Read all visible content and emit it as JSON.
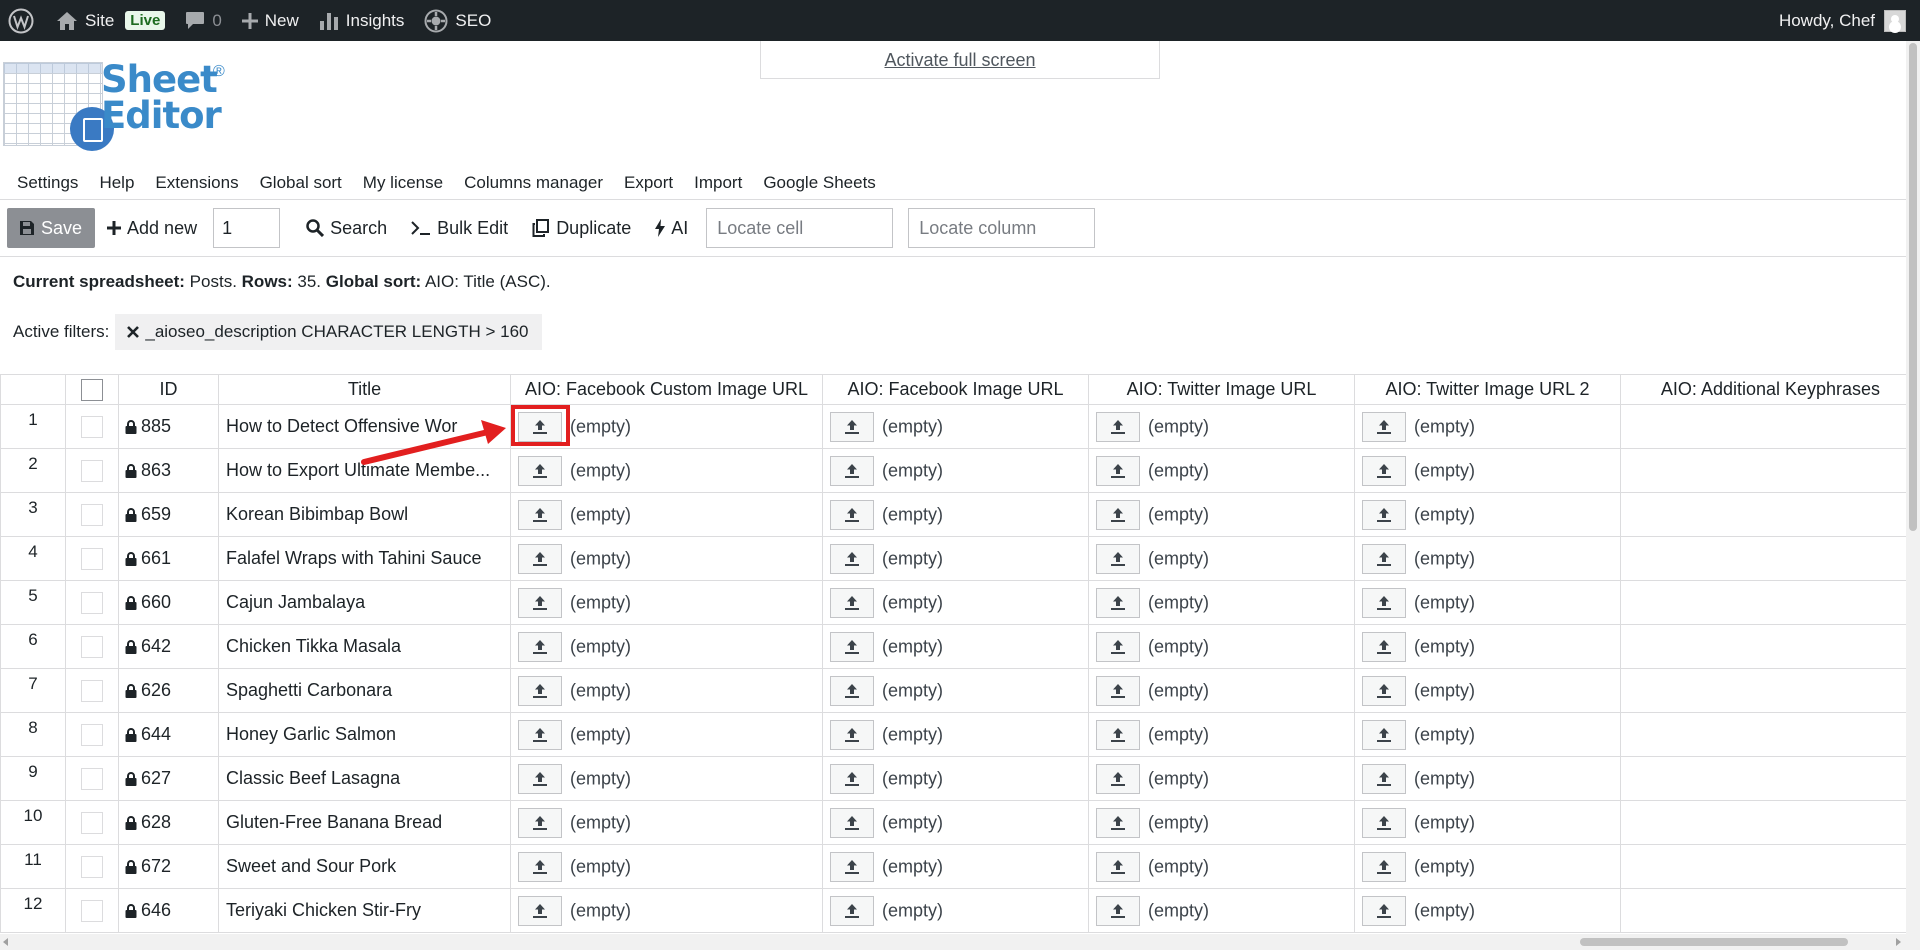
{
  "admin_bar": {
    "site": "Site",
    "live": "Live",
    "comments_count": "0",
    "new": "New",
    "insights": "Insights",
    "seo": "SEO",
    "greeting": "Howdy, Chef"
  },
  "fullscreen_link": "Activate full screen",
  "logo": {
    "line1": "Sheet",
    "line2": "Editor",
    "reg": "®"
  },
  "menu": [
    "Settings",
    "Help",
    "Extensions",
    "Global sort",
    "My license",
    "Columns manager",
    "Export",
    "Import",
    "Google Sheets"
  ],
  "toolbar": {
    "save": "Save",
    "add_new": "Add new",
    "add_count": "1",
    "search": "Search",
    "bulk_edit": "Bulk Edit",
    "duplicate": "Duplicate",
    "ai": "AI",
    "locate_cell_placeholder": "Locate cell",
    "locate_column_placeholder": "Locate column"
  },
  "info": {
    "spreadsheet_label": "Current spreadsheet:",
    "spreadsheet_value": "Posts.",
    "rows_label": "Rows:",
    "rows_value": "35.",
    "sort_label": "Global sort:",
    "sort_value": "AIO: Title (ASC)."
  },
  "filters": {
    "label": "Active filters:",
    "active": "_aioseo_description CHARACTER LENGTH > 160"
  },
  "columns": [
    "ID",
    "Title",
    "AIO: Facebook Custom Image URL",
    "AIO: Facebook Image URL",
    "AIO: Twitter Image URL",
    "AIO: Twitter Image URL 2",
    "AIO: Additional Keyphrases"
  ],
  "empty_label": "(empty)",
  "rows": [
    {
      "n": "1",
      "id": "885",
      "title": "How to Detect Offensive Wor"
    },
    {
      "n": "2",
      "id": "863",
      "title": "How to Export Ultimate Membe..."
    },
    {
      "n": "3",
      "id": "659",
      "title": "Korean Bibimbap Bowl"
    },
    {
      "n": "4",
      "id": "661",
      "title": "Falafel Wraps with Tahini Sauce"
    },
    {
      "n": "5",
      "id": "660",
      "title": "Cajun Jambalaya"
    },
    {
      "n": "6",
      "id": "642",
      "title": "Chicken Tikka Masala"
    },
    {
      "n": "7",
      "id": "626",
      "title": "Spaghetti Carbonara"
    },
    {
      "n": "8",
      "id": "644",
      "title": "Honey Garlic Salmon"
    },
    {
      "n": "9",
      "id": "627",
      "title": "Classic Beef Lasagna"
    },
    {
      "n": "10",
      "id": "628",
      "title": "Gluten-Free Banana Bread"
    },
    {
      "n": "11",
      "id": "672",
      "title": "Sweet and Sour Pork"
    },
    {
      "n": "12",
      "id": "646",
      "title": "Teriyaki Chicken Stir-Fry"
    }
  ],
  "colors": {
    "admin_bar": "#1d2327",
    "save_button": "#8c8f94",
    "highlight": "#e21f1f",
    "logo": "#3a8ac9"
  }
}
